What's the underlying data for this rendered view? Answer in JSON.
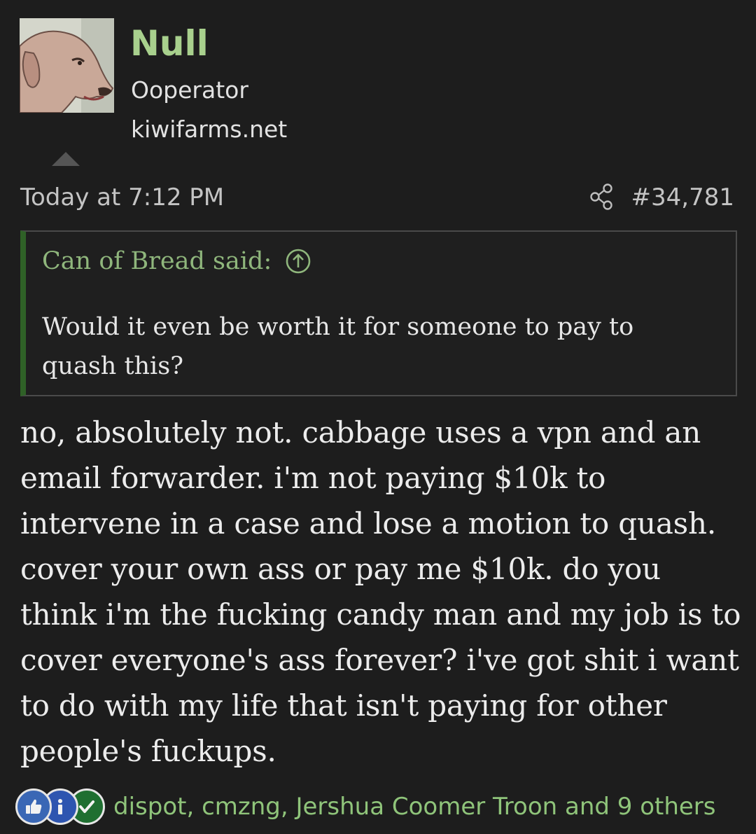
{
  "author": {
    "username": "Null",
    "title": "Ooperator",
    "site": "kiwifarms.net",
    "avatar_icon": "dog-avatar-icon"
  },
  "meta": {
    "timestamp": "Today at 7:12 PM",
    "post_number": "#34,781",
    "share_icon": "share-icon"
  },
  "quote": {
    "attribution": "Can of Bread said:",
    "text": "Would it even be worth it for someone to pay to quash this?",
    "jump_icon": "arrow-up-circle-icon"
  },
  "body": "no, absolutely not. cabbage uses a vpn and an email forwarder. i'm not paying $10k to intervene in a case and lose a motion to quash. cover your own ass or pay me $10k. do you think i'm the fucking candy man and my job is to cover everyone's ass forever? i've got shit i want to do with my life that isn't paying for other people's fuckups.",
  "reactions": {
    "icons": [
      "thumbs-up-icon",
      "info-icon",
      "checkmark-icon"
    ],
    "users_text": "dispot, cmzng, Jershua Coomer Troon and 9 others"
  },
  "colors": {
    "background": "#1d1d1d",
    "username": "#a8d08d",
    "quote_border_accent": "#2f6127",
    "quote_attribution": "#8fb67c",
    "reaction_users": "#8fc47a"
  }
}
